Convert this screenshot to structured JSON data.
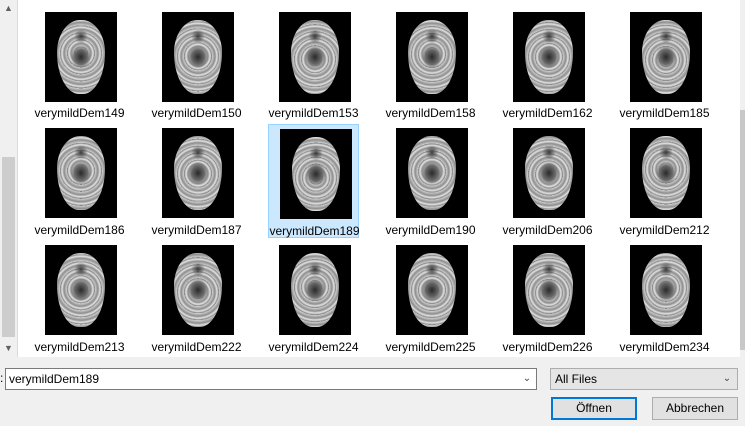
{
  "files": [
    {
      "name": "verymildDem149"
    },
    {
      "name": "verymildDem150"
    },
    {
      "name": "verymildDem153"
    },
    {
      "name": "verymildDem158"
    },
    {
      "name": "verymildDem162"
    },
    {
      "name": "verymildDem185"
    },
    {
      "name": "verymildDem186"
    },
    {
      "name": "verymildDem187"
    },
    {
      "name": "verymildDem189",
      "selected": true
    },
    {
      "name": "verymildDem190"
    },
    {
      "name": "verymildDem206"
    },
    {
      "name": "verymildDem212"
    },
    {
      "name": "verymildDem213"
    },
    {
      "name": "verymildDem222"
    },
    {
      "name": "verymildDem224"
    },
    {
      "name": "verymildDem225"
    },
    {
      "name": "verymildDem226"
    },
    {
      "name": "verymildDem234"
    }
  ],
  "filename": {
    "label": ":",
    "value": "verymildDem189"
  },
  "filetype": {
    "selected": "All Files"
  },
  "buttons": {
    "open": "Öffnen",
    "cancel": "Abbrechen"
  },
  "icons": {
    "scroll_up": "chevron-up-icon",
    "scroll_down": "chevron-down-icon",
    "dropdown": "chevron-down-icon"
  },
  "colors": {
    "selection_fill": "#cce8ff",
    "selection_border": "#99d1ff",
    "default_button_border": "#0078d7"
  }
}
